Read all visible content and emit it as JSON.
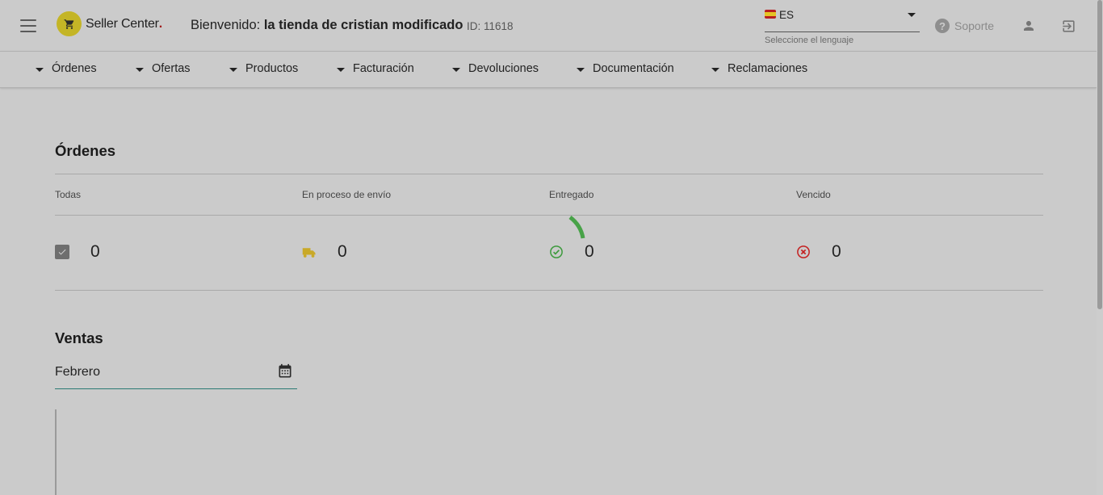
{
  "header": {
    "logo_text": "Seller Center",
    "logo_dot": ".",
    "welcome_prefix": "Bienvenido:",
    "store_name": "la tienda de cristian modificado",
    "store_id": "ID: 11618",
    "language": {
      "value": "ES",
      "hint": "Seleccione el lenguaje"
    },
    "support_label": "Soporte",
    "icons": [
      "menu-icon",
      "cart-icon",
      "help-icon",
      "user-icon",
      "logout-icon"
    ]
  },
  "nav": {
    "items": [
      {
        "label": "Órdenes"
      },
      {
        "label": "Ofertas"
      },
      {
        "label": "Productos"
      },
      {
        "label": "Facturación"
      },
      {
        "label": "Devoluciones"
      },
      {
        "label": "Documentación"
      },
      {
        "label": "Reclamaciones"
      }
    ]
  },
  "orders": {
    "title": "Órdenes",
    "columns": [
      {
        "label": "Todas",
        "value": "0",
        "icon": "checkbox-icon"
      },
      {
        "label": "En proceso de envío",
        "value": "0",
        "icon": "truck-icon"
      },
      {
        "label": "Entregado",
        "value": "0",
        "icon": "check-circle-icon"
      },
      {
        "label": "Vencido",
        "value": "0",
        "icon": "cancel-circle-icon"
      }
    ]
  },
  "sales": {
    "title": "Ventas",
    "month": "Febrero"
  },
  "colors": {
    "background": "#cbcbcb",
    "logo": "#c4b526",
    "truck": "#c9a928",
    "success": "#3c9a3c",
    "error": "#c42020",
    "spinner": "#48a248",
    "field_underline": "#2a7a73"
  }
}
